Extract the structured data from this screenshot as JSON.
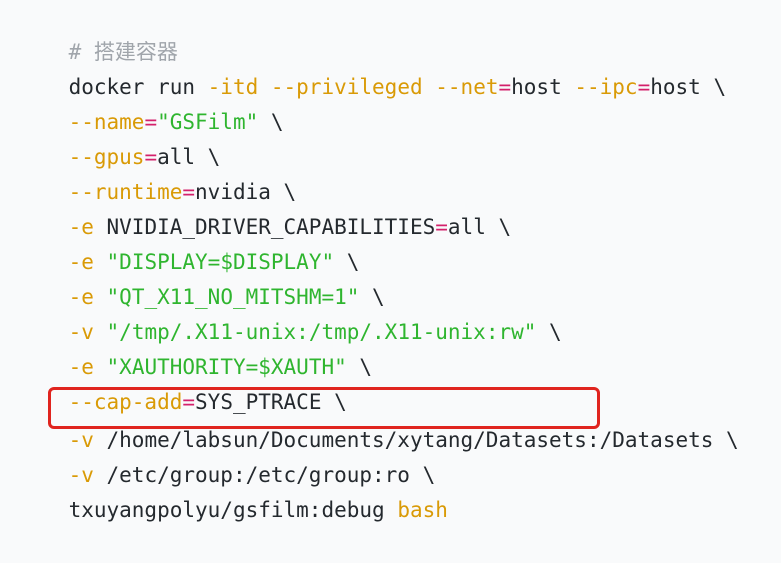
{
  "code": {
    "comment": "# 搭建容器",
    "line1": {
      "cmd": "docker run ",
      "flag_itd": "-itd",
      "flag_privileged": "--privileged",
      "flag_net": "--net",
      "eq": "=",
      "net_value": "host ",
      "flag_ipc": "--ipc",
      "ipc_value": "host \\"
    },
    "line2": {
      "flag": "--name",
      "eq": "=",
      "value": "\"GSFilm\"",
      "cont": " \\"
    },
    "line3": {
      "flag": "--gpus",
      "eq": "=",
      "value": "all \\"
    },
    "line4": {
      "flag": "--runtime",
      "eq": "=",
      "value": "nvidia \\"
    },
    "line5": {
      "flag": "-e",
      "text": " NVIDIA_DRIVER_CAPABILITIES",
      "eq": "=",
      "value": "all \\"
    },
    "line6": {
      "flag": "-e",
      "value": "\"DISPLAY=$DISPLAY\"",
      "cont": " \\"
    },
    "line7": {
      "flag": "-e",
      "value": "\"QT_X11_NO_MITSHM=1\"",
      "cont": " \\"
    },
    "line8": {
      "flag": "-v",
      "value": "\"/tmp/.X11-unix:/tmp/.X11-unix:rw\"",
      "cont": " \\"
    },
    "line9": {
      "flag": "-e",
      "value": "\"XAUTHORITY=$XAUTH\"",
      "cont": " \\"
    },
    "line10": {
      "flag": "--cap-add",
      "eq": "=",
      "value": "SYS_PTRACE \\"
    },
    "line11": {
      "flag": "-v",
      "path": " /home/labsun/Documents/xytang/Datasets",
      "rest": ":/Datasets \\"
    },
    "line12": {
      "flag": "-v",
      "value": " /etc/group:/etc/group:ro \\"
    },
    "line13": {
      "image": "txuyangpolyu/gsfilm:debug ",
      "cmd": "bash"
    }
  },
  "colors": {
    "background": "#f9fafb",
    "comment": "#a0a5ab",
    "flag": "#d99a06",
    "operator": "#d4206b",
    "string": "#2fb52f",
    "text": "#24292e",
    "highlight_border": "#e0241e"
  }
}
